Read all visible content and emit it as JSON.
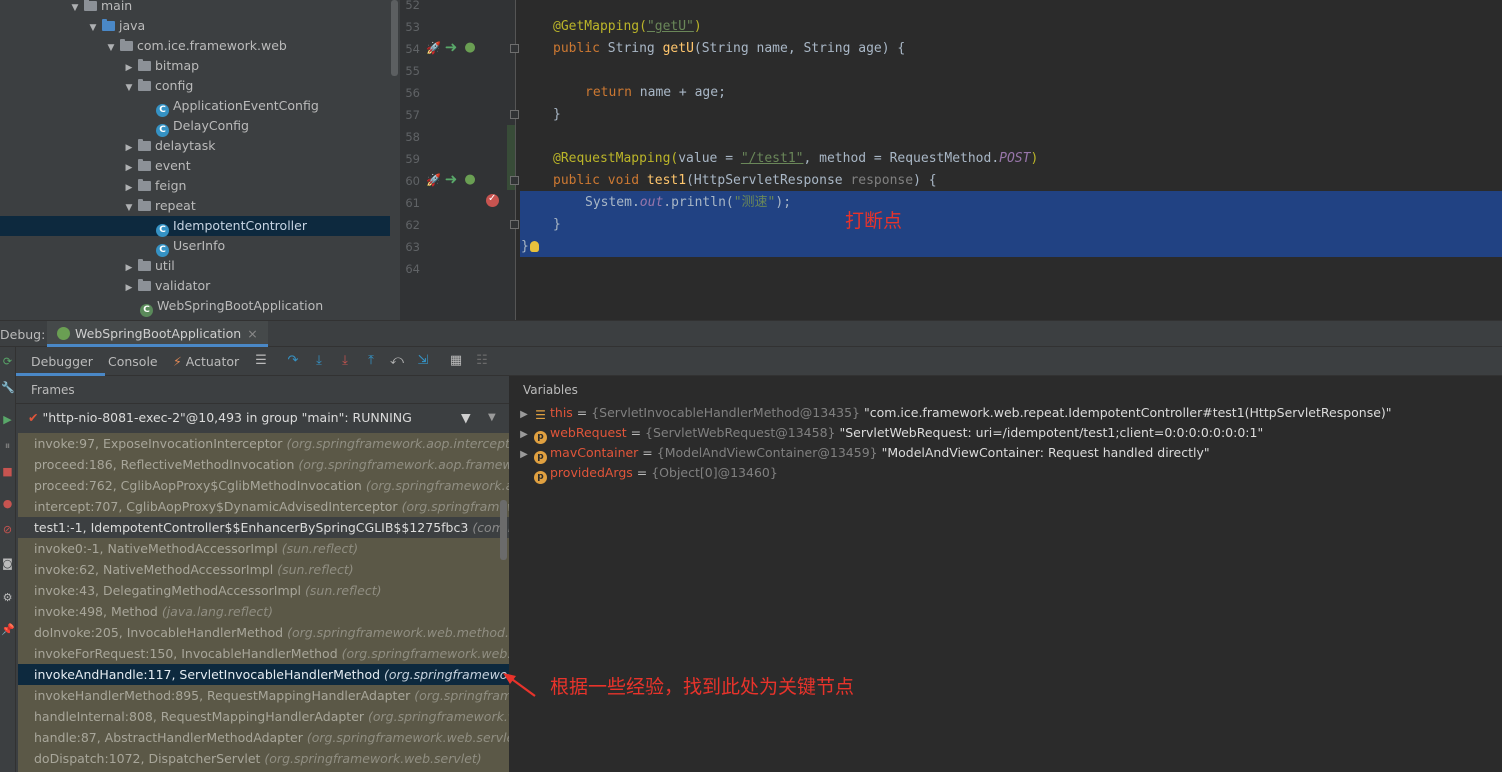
{
  "project_tree": {
    "items": [
      {
        "label": "main",
        "kind": "folder"
      },
      {
        "label": "java",
        "kind": "src-folder"
      },
      {
        "label": "com.ice.framework.web",
        "kind": "package"
      },
      {
        "label": "bitmap",
        "kind": "package"
      },
      {
        "label": "config",
        "kind": "package"
      },
      {
        "label": "ApplicationEventConfig",
        "kind": "class"
      },
      {
        "label": "DelayConfig",
        "kind": "class"
      },
      {
        "label": "delaytask",
        "kind": "package"
      },
      {
        "label": "event",
        "kind": "package"
      },
      {
        "label": "feign",
        "kind": "package"
      },
      {
        "label": "repeat",
        "kind": "package"
      },
      {
        "label": "IdempotentController",
        "kind": "class",
        "selected": true
      },
      {
        "label": "UserInfo",
        "kind": "class"
      },
      {
        "label": "util",
        "kind": "package"
      },
      {
        "label": "validator",
        "kind": "package"
      },
      {
        "label": "WebSpringBootApplication",
        "kind": "spring-class"
      }
    ]
  },
  "editor": {
    "line_numbers": [
      "52",
      "53",
      "54",
      "55",
      "56",
      "57",
      "58",
      "59",
      "60",
      "61",
      "62",
      "63",
      "64"
    ],
    "code": {
      "l53_ann": "@GetMapping(",
      "l53_str": "\"getU\"",
      "l53_end": ")",
      "l54_kw": "public ",
      "l54_type": "String ",
      "l54_fn": "getU",
      "l54_rest": "(String name, String age) {",
      "l56_kw": "return ",
      "l56_rest": "name + age;",
      "l57": "}",
      "l59_ann": "@RequestMapping(",
      "l59_a": "value = ",
      "l59_str": "\"/test1\"",
      "l59_b": ", method = RequestMethod.",
      "l59_post": "POST",
      "l59_end": ")",
      "l60_kw": "public void ",
      "l60_fn": "test1",
      "l60_rest": "(HttpServletResponse ",
      "l60_param": "response",
      "l60_end": ") {",
      "l61_a": "System.",
      "l61_out": "out",
      "l61_b": ".println(",
      "l61_str": "\"测速\"",
      "l61_end": ");",
      "l62": "}",
      "l63": "}"
    }
  },
  "annotations": {
    "breakpoint_note": "打断点",
    "key_node_note": "根据一些经验，找到此处为关键节点"
  },
  "debug": {
    "label": "Debug:",
    "session_tab": "WebSpringBootApplication",
    "close_glyph": "×",
    "tabs": {
      "debugger": "Debugger",
      "console": "Console",
      "actuator": "Actuator"
    },
    "frames_title": "Frames",
    "variables_title": "Variables",
    "thread": "\"http-nio-8081-exec-2\"@10,493 in group \"main\": RUNNING",
    "frames": [
      {
        "method": "invoke:97, ExposeInvocationInterceptor",
        "pkg": "(org.springframework.aop.interceptor)",
        "style": "lib"
      },
      {
        "method": "proceed:186, ReflectiveMethodInvocation",
        "pkg": "(org.springframework.aop.framework)",
        "style": "lib"
      },
      {
        "method": "proceed:762, CglibAopProxy$CglibMethodInvocation",
        "pkg": "(org.springframework.aop.fr",
        "style": "lib"
      },
      {
        "method": "intercept:707, CglibAopProxy$DynamicAdvisedInterceptor",
        "pkg": "(org.springframework.a",
        "style": "lib"
      },
      {
        "method": "test1:-1, IdempotentController$$EnhancerBySpringCGLIB$$1275fbc3",
        "pkg": "(com.ice.fran",
        "style": "user"
      },
      {
        "method": "invoke0:-1, NativeMethodAccessorImpl",
        "pkg": "(sun.reflect)",
        "style": "lib"
      },
      {
        "method": "invoke:62, NativeMethodAccessorImpl",
        "pkg": "(sun.reflect)",
        "style": "lib"
      },
      {
        "method": "invoke:43, DelegatingMethodAccessorImpl",
        "pkg": "(sun.reflect)",
        "style": "lib"
      },
      {
        "method": "invoke:498, Method",
        "pkg": "(java.lang.reflect)",
        "style": "lib"
      },
      {
        "method": "doInvoke:205, InvocableHandlerMethod",
        "pkg": "(org.springframework.web.method.supp",
        "style": "lib"
      },
      {
        "method": "invokeForRequest:150, InvocableHandlerMethod",
        "pkg": "(org.springframework.web.meth",
        "style": "lib"
      },
      {
        "method": "invokeAndHandle:117, ServletInvocableHandlerMethod",
        "pkg": "(org.springframework.wel",
        "style": "selected"
      },
      {
        "method": "invokeHandlerMethod:895, RequestMappingHandlerAdapter",
        "pkg": "(org.springframewo",
        "style": "lib"
      },
      {
        "method": "handleInternal:808, RequestMappingHandlerAdapter",
        "pkg": "(org.springframework.web.s",
        "style": "lib"
      },
      {
        "method": "handle:87, AbstractHandlerMethodAdapter",
        "pkg": "(org.springframework.web.servlet.mvc",
        "style": "lib"
      },
      {
        "method": "doDispatch:1072, DispatcherServlet",
        "pkg": "(org.springframework.web.servlet)",
        "style": "lib"
      }
    ],
    "variables": [
      {
        "name": "this",
        "type": "{ServletInvocableHandlerMethod@13435}",
        "value": "\"com.ice.framework.web.repeat.IdempotentController#test1(HttpServletResponse)\"",
        "icon": "fields-icon",
        "expandable": true
      },
      {
        "name": "webRequest",
        "type": "{ServletWebRequest@13458}",
        "value": "\"ServletWebRequest: uri=/idempotent/test1;client=0:0:0:0:0:0:0:1\"",
        "icon": "param-icon",
        "expandable": true
      },
      {
        "name": "mavContainer",
        "type": "{ModelAndViewContainer@13459}",
        "value": "\"ModelAndViewContainer: Request handled directly\"",
        "icon": "param-icon",
        "expandable": true
      },
      {
        "name": "providedArgs",
        "type": "{Object[0]@13460}",
        "value": "",
        "icon": "param-icon",
        "expandable": false
      }
    ]
  }
}
